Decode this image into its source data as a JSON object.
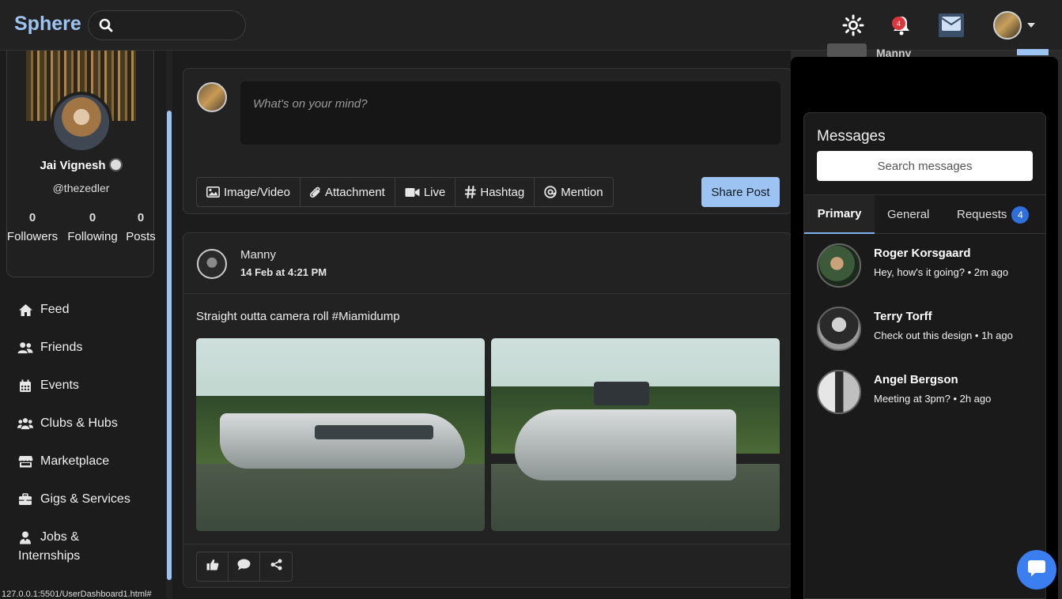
{
  "app": {
    "brand": "Sphere"
  },
  "header": {
    "notification_count": "4"
  },
  "profile": {
    "name": "Jai Vignesh",
    "handle": "@thezedler",
    "stats": [
      {
        "value": "0",
        "label": "Followers"
      },
      {
        "value": "0",
        "label": "Following"
      },
      {
        "value": "0",
        "label": "Posts"
      }
    ]
  },
  "nav": {
    "items": [
      {
        "label": "Feed",
        "icon": "home-icon"
      },
      {
        "label": "Friends",
        "icon": "friends-icon"
      },
      {
        "label": "Events",
        "icon": "calendar-icon"
      },
      {
        "label": "Clubs & Hubs",
        "icon": "group-icon"
      },
      {
        "label": "Marketplace",
        "icon": "store-icon"
      },
      {
        "label": "Gigs & Services",
        "icon": "briefcase-icon"
      },
      {
        "label": "Jobs &",
        "label2": "Internships",
        "icon": "user-tie-icon"
      }
    ]
  },
  "status_bar": {
    "url": "127.0.0.1:5501/UserDashboard1.html#"
  },
  "composer": {
    "placeholder": "What's on your mind?",
    "tools": [
      "Image/Video",
      "Attachment",
      "Live",
      "Hashtag",
      "Mention"
    ],
    "share_label": "Share Post"
  },
  "post": {
    "author": "Manny",
    "time": "14 Feb at 4:21 PM",
    "text": "Straight outta camera roll #Miamidump"
  },
  "behind": {
    "name": "Manny"
  },
  "messages": {
    "title": "Messages",
    "search_placeholder": "Search messages",
    "tabs": [
      {
        "label": "Primary"
      },
      {
        "label": "General"
      },
      {
        "label": "Requests",
        "count": "4"
      }
    ],
    "conversations": [
      {
        "name": "Roger Korsgaard",
        "preview": "Hey, how's it going? • 2m ago"
      },
      {
        "name": "Terry Torff",
        "preview": "Check out this design • 1h ago"
      },
      {
        "name": "Angel Bergson",
        "preview": "Meeting at 3pm? • 2h ago"
      }
    ]
  },
  "colors": {
    "accent": "#9cc3f2",
    "badge": "#d9363e",
    "fab": "#3a7ef0"
  }
}
